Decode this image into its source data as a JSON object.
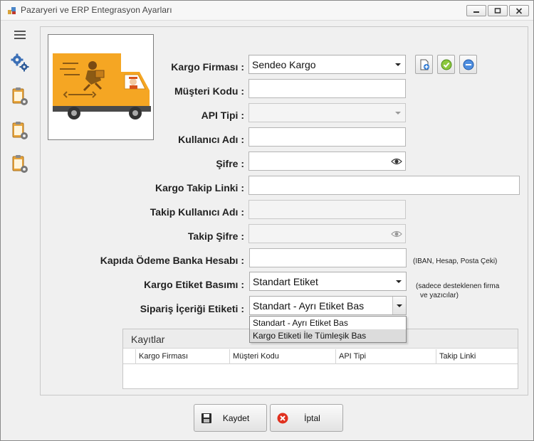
{
  "window": {
    "title": "Pazaryeri ve ERP Entegrasyon Ayarları"
  },
  "form": {
    "kargo_firmasi": {
      "label": "Kargo Firması :",
      "value": "Sendeo Kargo"
    },
    "musteri_kodu": {
      "label": "Müşteri Kodu :",
      "value": ""
    },
    "api_tipi": {
      "label": "API Tipi :",
      "value": ""
    },
    "kullanici_adi": {
      "label": "Kullanıcı Adı :",
      "value": ""
    },
    "sifre": {
      "label": "Şifre :",
      "value": ""
    },
    "kargo_takip_linki": {
      "label": "Kargo Takip Linki :",
      "value": ""
    },
    "takip_kullanici_adi": {
      "label": "Takip Kullanıcı Adı :",
      "value": ""
    },
    "takip_sifre": {
      "label": "Takip Şifre :",
      "value": ""
    },
    "kapida_odeme": {
      "label": "Kapıda Ödeme Banka Hesabı :",
      "value": "",
      "note": "(IBAN, Hesap, Posta Çeki)"
    },
    "kargo_etiket_basimi": {
      "label": "Kargo Etiket Basımı :",
      "value": "Standart Etiket",
      "note_line1": "(sadece desteklenen firma",
      "note_line2": "ve yazıcılar)"
    },
    "siparis_icerigi_etiketi": {
      "label": "Sipariş İçeriği Etiketi :",
      "value": "Standart - Ayrı Etiket Bas",
      "options": [
        "Standart - Ayrı Etiket Bas",
        "Kargo Etiketi İle Tümleşik Bas"
      ]
    }
  },
  "records": {
    "title": "Kayıtlar",
    "columns": [
      "Kargo Firması",
      "Müşteri Kodu",
      "API Tipi",
      "Takip Linki"
    ]
  },
  "buttons": {
    "save": "Kaydet",
    "cancel": "İptal"
  },
  "colors": {
    "truck_orange": "#f5a623",
    "panel_bg": "#f0f0f0"
  }
}
